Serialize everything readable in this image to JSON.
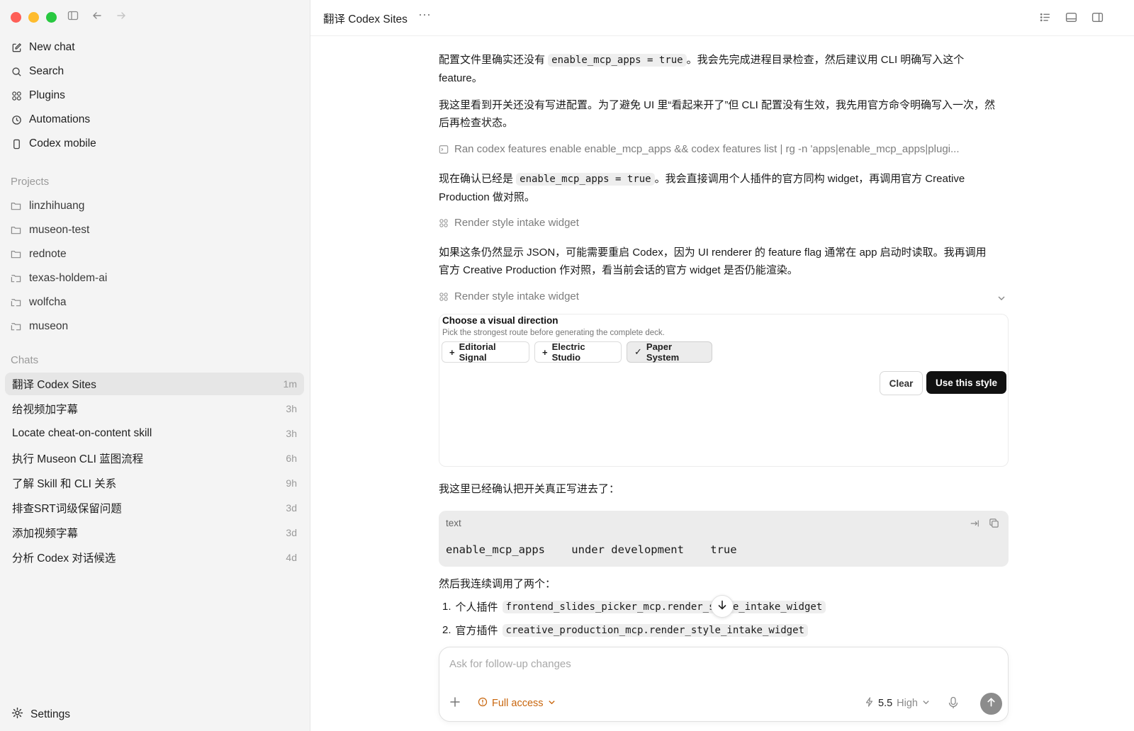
{
  "sidebar": {
    "nav": [
      {
        "label": "New chat",
        "icon": "compose-icon"
      },
      {
        "label": "Search",
        "icon": "search-icon"
      },
      {
        "label": "Plugins",
        "icon": "plugins-icon"
      },
      {
        "label": "Automations",
        "icon": "clock-icon"
      },
      {
        "label": "Codex mobile",
        "icon": "phone-icon"
      }
    ],
    "projects_heading": "Projects",
    "projects": [
      "linzhihuang",
      "museon-test",
      "rednote",
      "texas-holdem-ai",
      "wolfcha",
      "museon"
    ],
    "chats_heading": "Chats",
    "chats": [
      {
        "title": "翻译 Codex Sites",
        "time": "1m"
      },
      {
        "title": "给视频加字幕",
        "time": "3h"
      },
      {
        "title": "Locate cheat-on-content skill",
        "time": "3h"
      },
      {
        "title": "执行 Museon CLI 蓝图流程",
        "time": "6h"
      },
      {
        "title": "了解 Skill 和 CLI 关系",
        "time": "9h"
      },
      {
        "title": "排查SRT词级保留问题",
        "time": "3d"
      },
      {
        "title": "添加视频字幕",
        "time": "3d"
      },
      {
        "title": "分析 Codex 对话候选",
        "time": "4d"
      }
    ],
    "settings_label": "Settings"
  },
  "header": {
    "title": "翻译 Codex Sites",
    "more": "···"
  },
  "messages": {
    "p1_a": "配置文件里确实还没有 ",
    "p1_code": "enable_mcp_apps = true",
    "p1_b": "。我会先完成进程目录检查，然后建议用 CLI 明确写入这个",
    "p1_c": "feature。",
    "p2_line1": "我这里看到开关还没有写进配置。为了避免 UI 里“看起来开了”但 CLI 配置没有生效，我先用官方命令明确写入一次，然",
    "p2_line2": "后再检查状态。",
    "tool1": "Ran codex features enable enable_mcp_apps && codex features list | rg -n 'apps|enable_mcp_apps|plugi...",
    "p3_a": "现在确认已经是 ",
    "p3_code": "enable_mcp_apps = true",
    "p3_b": "。我会直接调用个人插件的官方同构 widget，再调用官方 Creative",
    "p3_c": "Production 做对照。",
    "tool2": "Render style intake widget",
    "p4_line1": "如果这条仍然显示 JSON，可能需要重启 Codex，因为 UI renderer 的 feature flag 通常在 app 启动时读取。我再调用",
    "p4_line2": "官方 Creative Production 作对照，看当前会话的官方 widget 是否仍能渲染。",
    "tool3": "Render style intake widget",
    "p5": "我这里已经确认把开关真正写进去了：",
    "code_lang": "text",
    "code_line": "enable_mcp_apps    under development    true",
    "p6": "然后我连续调用了两个：",
    "list": [
      {
        "num": "1.",
        "text": "个人插件",
        "code": "frontend_slides_picker_mcp.render_style_intake_widget"
      },
      {
        "num": "2.",
        "text": "官方插件",
        "code": "creative_production_mcp.render_style_intake_widget"
      }
    ]
  },
  "widget": {
    "title": "Choose a visual direction",
    "subtitle": "Pick the strongest route before generating the complete deck.",
    "options": [
      {
        "label": "Editorial Signal",
        "prefix": "+",
        "selected": false
      },
      {
        "label": "Electric Studio",
        "prefix": "+",
        "selected": false
      },
      {
        "label": "Paper System",
        "prefix": "✓",
        "selected": true
      }
    ],
    "clear_label": "Clear",
    "use_label": "Use this style"
  },
  "composer": {
    "placeholder": "Ask for follow-up changes",
    "access_label": "Full access",
    "model_version": "5.5",
    "effort": "High"
  },
  "colors": {
    "access": "#c8650c",
    "send_button": "#8c8c8c",
    "primary_button": "#111111"
  }
}
